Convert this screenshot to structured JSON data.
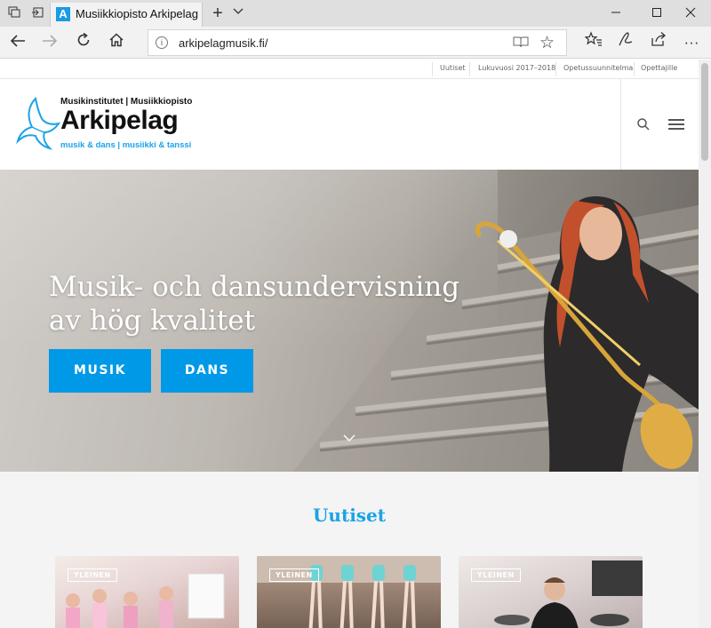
{
  "browser": {
    "tab_title": "Musiikkiopisto Arkipelag",
    "favicon_letter": "A",
    "url": "arkipelagmusik.fi/",
    "icons": [
      "tab-set-aside-icon",
      "back-tabs-icon",
      "close-icon",
      "plus-icon",
      "chevron-down-icon",
      "minimize-icon",
      "restore-icon",
      "close-window-icon",
      "back-arrow-icon",
      "forward-arrow-icon",
      "refresh-icon",
      "home-icon",
      "info-icon",
      "reading-view-icon",
      "star-icon",
      "favorites-icon",
      "pen-icon",
      "share-icon",
      "more-icon"
    ]
  },
  "site": {
    "top_nav": [
      {
        "label": "Uutiset"
      },
      {
        "label": "Lukuvuosi 2017–2018"
      },
      {
        "label": "Opetussuunnitelma"
      },
      {
        "label": "Opettajille"
      }
    ],
    "logo": {
      "top_line": "Musikinstitutet | Musiikkiopisto",
      "name": "Arkipelag",
      "sub_line": "musik & dans | musiikki & tanssi"
    },
    "hero": {
      "title_line1": "Musik- och dansundervisning",
      "title_line2": "av hög kvalitet",
      "button_music": "MUSIK",
      "button_dance": "DANS"
    },
    "news": {
      "title": "Uutiset",
      "cards": [
        {
          "badge": "YLEINEN"
        },
        {
          "badge": "YLEINEN"
        },
        {
          "badge": "YLEINEN"
        }
      ]
    },
    "colors": {
      "accent": "#0099e8",
      "heading_blue": "#1aa3e8"
    }
  }
}
